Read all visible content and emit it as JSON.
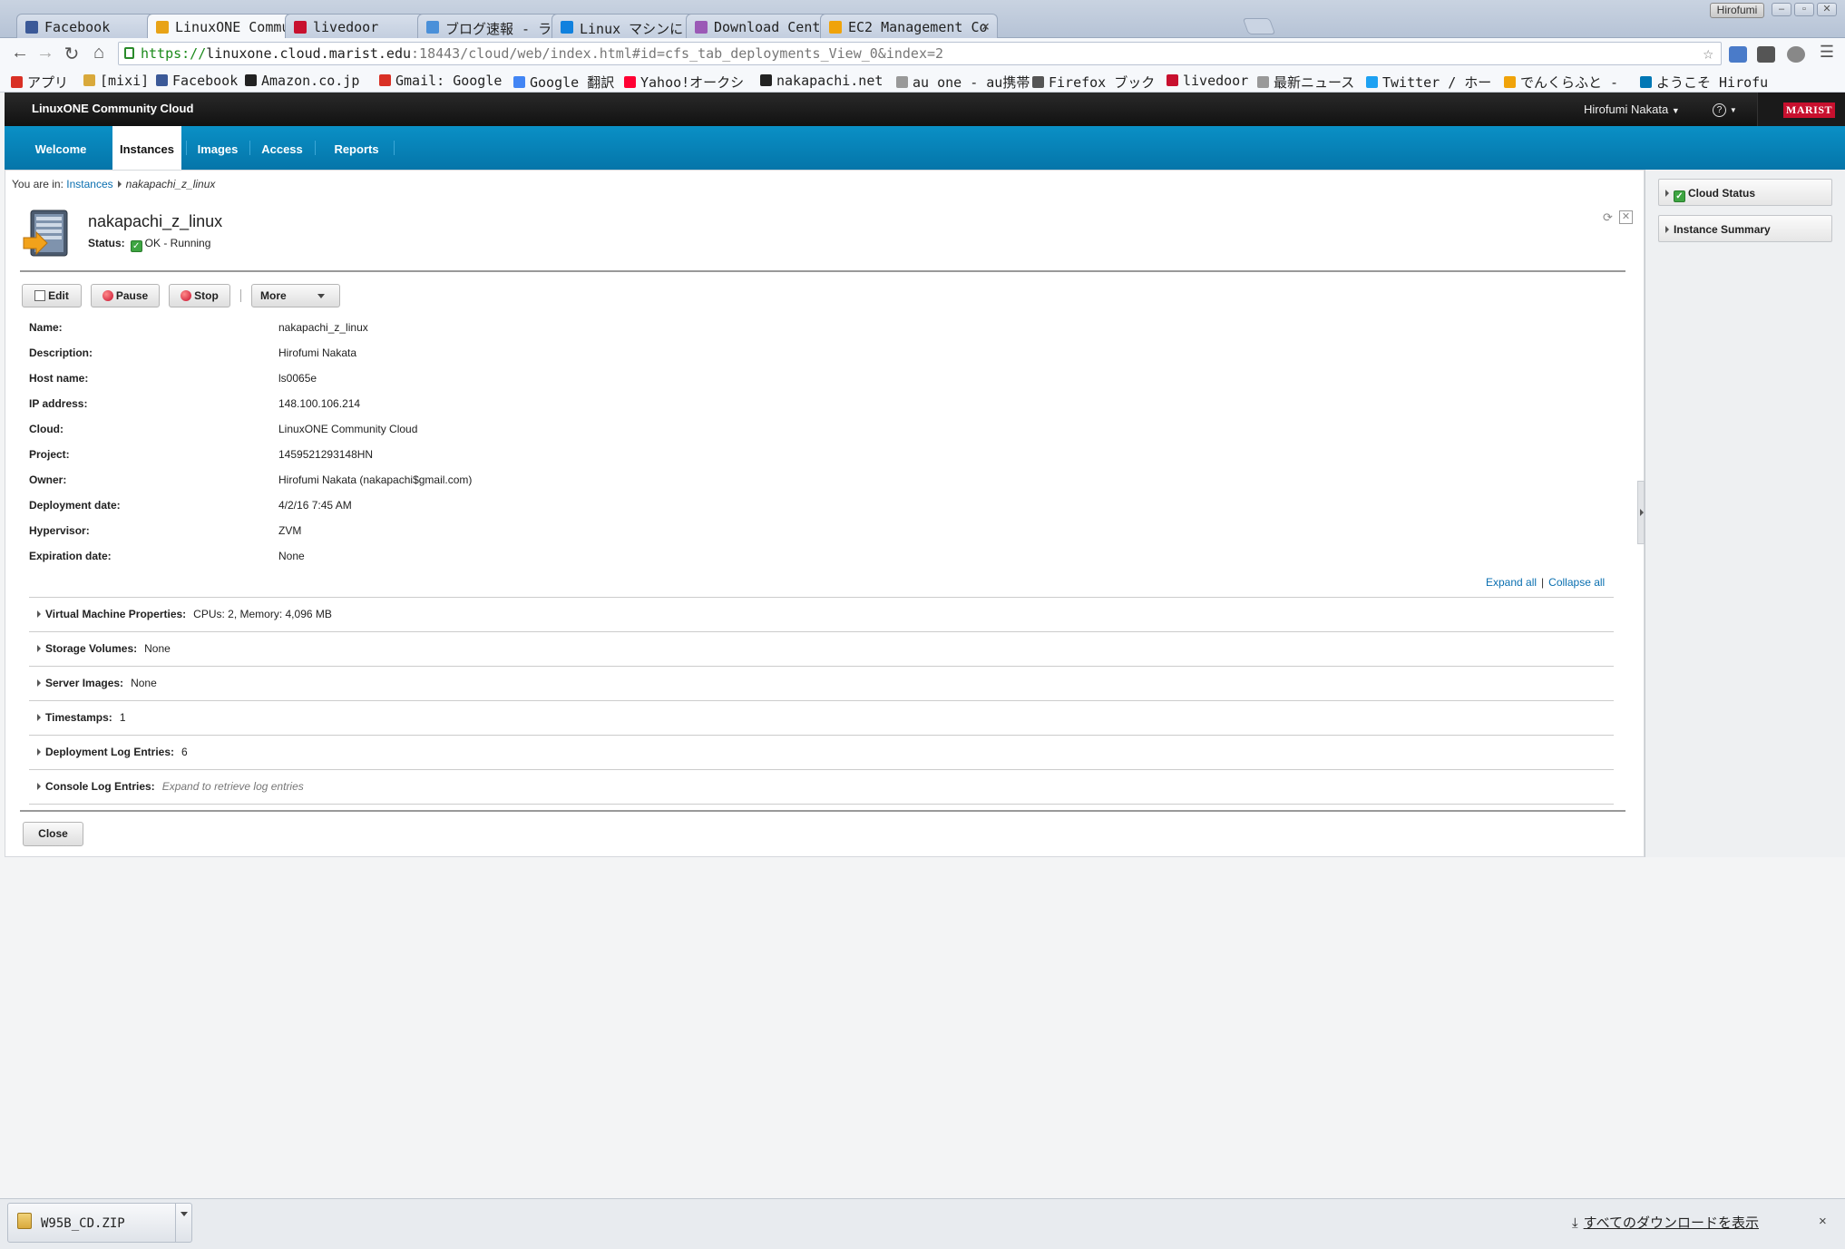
{
  "browser": {
    "profile_name": "Hirofumi",
    "window_buttons": [
      "–",
      "▫",
      "✕"
    ],
    "tabs": [
      {
        "label": "Facebook",
        "favicon_color": "#3b5998",
        "active": false
      },
      {
        "label": "LinuxONE Communit",
        "favicon_color": "#e8a317",
        "active": true
      },
      {
        "label": "livedoor",
        "favicon_color": "#c8102e",
        "active": false
      },
      {
        "label": "ブログ速報 - ライン",
        "favicon_color": "#4a90d9",
        "active": false
      },
      {
        "label": "Linux マシンに Dro",
        "favicon_color": "#1081de",
        "active": false
      },
      {
        "label": "Download CentOS",
        "favicon_color": "#9b59b6",
        "active": false
      },
      {
        "label": "EC2 Management Co",
        "favicon_color": "#f0a30a",
        "active": false
      }
    ],
    "url_scheme": "https://",
    "url_host": "linuxone.cloud.marist.edu",
    "url_path": ":18443/cloud/web/index.html#id=cfs_tab_deployments_View_0&index=2",
    "bookmarks": [
      {
        "label": "アプリ",
        "icon_color": "#d93025"
      },
      {
        "label": "[mixi]",
        "icon_color": "#d9a93b"
      },
      {
        "label": "Facebook",
        "icon_color": "#3b5998"
      },
      {
        "label": "Amazon.co.jp",
        "icon_color": "#222222"
      },
      {
        "label": "Gmail: Google",
        "icon_color": "#d93025"
      },
      {
        "label": "Google 翻訳",
        "icon_color": "#4285f4"
      },
      {
        "label": "Yahoo!オークシ",
        "icon_color": "#ff0033"
      },
      {
        "label": "nakapachi.net",
        "icon_color": "#222222"
      },
      {
        "label": "au one - au携帯",
        "icon_color": "#999999"
      },
      {
        "label": "Firefox ブック",
        "icon_color": "#555555"
      },
      {
        "label": "livedoor",
        "icon_color": "#c8102e"
      },
      {
        "label": "最新ニュース",
        "icon_color": "#999999"
      },
      {
        "label": "Twitter / ホー",
        "icon_color": "#1da1f2"
      },
      {
        "label": "でんくらふと -",
        "icon_color": "#f0a30a"
      },
      {
        "label": "ようこそ Hirofu",
        "icon_color": "#0077b5"
      }
    ]
  },
  "app": {
    "title": "LinuxONE Community Cloud",
    "user": "Hirofumi Nakata",
    "help_icon": "?",
    "logo_text": "MARIST",
    "nav_tabs": [
      {
        "label": "Welcome",
        "active": false
      },
      {
        "label": "Instances",
        "active": true
      },
      {
        "label": "Images",
        "active": false
      },
      {
        "label": "Access",
        "active": false
      },
      {
        "label": "Reports",
        "active": false
      }
    ]
  },
  "breadcrumb": {
    "prefix": "You are in:",
    "link": "Instances",
    "current": "nakapachi_z_linux"
  },
  "instance": {
    "name": "nakapachi_z_linux",
    "status_label": "Status:",
    "status_value": "OK - Running"
  },
  "actions": {
    "edit": "Edit",
    "pause": "Pause",
    "stop": "Stop",
    "more": "More",
    "close": "Close"
  },
  "properties": [
    {
      "label": "Name:",
      "value": "nakapachi_z_linux"
    },
    {
      "label": "Description:",
      "value": "Hirofumi Nakata"
    },
    {
      "label": "Host name:",
      "value": "ls0065e"
    },
    {
      "label": "IP address:",
      "value": "148.100.106.214"
    },
    {
      "label": "Cloud:",
      "value": "LinuxONE Community Cloud"
    },
    {
      "label": "Project:",
      "value": "1459521293148HN"
    },
    {
      "label": "Owner:",
      "value": "Hirofumi Nakata (nakapachi$gmail.com)"
    },
    {
      "label": "Deployment date:",
      "value": "4/2/16 7:45 AM"
    },
    {
      "label": "Hypervisor:",
      "value": "ZVM"
    },
    {
      "label": "Expiration date:",
      "value": "None"
    }
  ],
  "expand_links": {
    "expand": "Expand all",
    "separator": "|",
    "collapse": "Collapse all"
  },
  "sections": [
    {
      "label": "Virtual Machine Properties:",
      "value": "CPUs:  2,  Memory:  4,096 MB"
    },
    {
      "label": "Storage Volumes:",
      "value": "None"
    },
    {
      "label": "Server Images:",
      "value": "None"
    },
    {
      "label": "Timestamps:",
      "value": "1"
    },
    {
      "label": "Deployment Log Entries:",
      "value": "6"
    },
    {
      "label": "Console Log Entries:",
      "hint": "Expand to retrieve log entries"
    }
  ],
  "sidebar": {
    "panels": [
      {
        "label": "Cloud Status",
        "has_check": true
      },
      {
        "label": "Instance Summary",
        "has_check": false
      }
    ]
  },
  "downloads": {
    "file_name": "W95B_CD.ZIP",
    "show_all": "すべてのダウンロードを表示",
    "close": "×"
  }
}
